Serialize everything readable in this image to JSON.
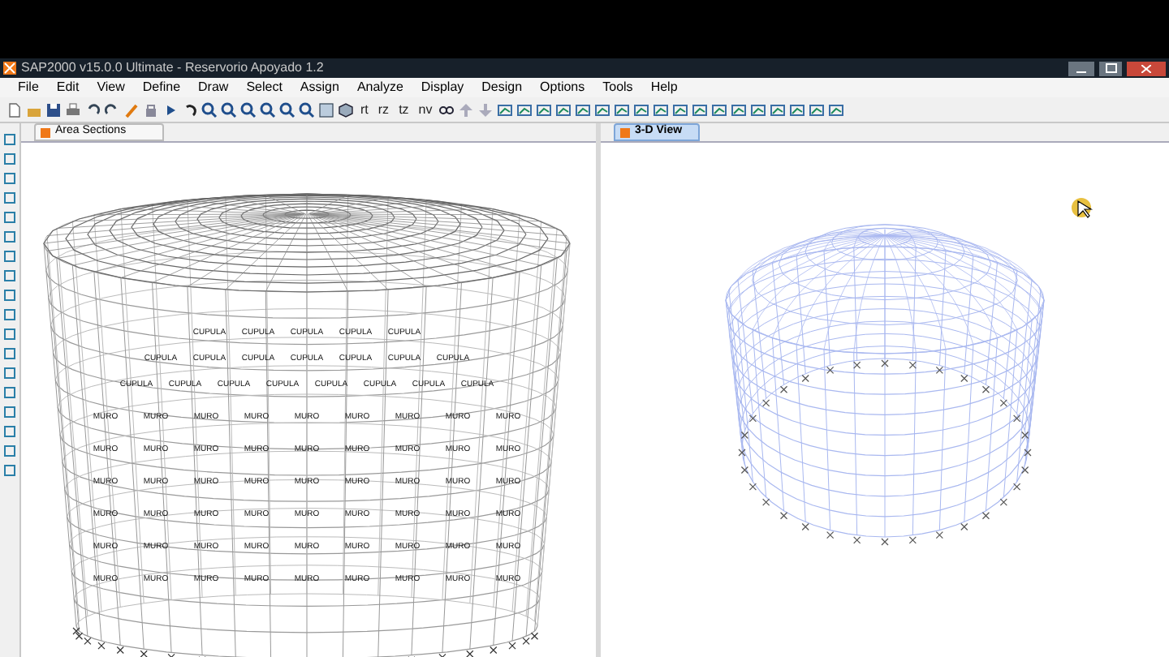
{
  "window": {
    "title": "SAP2000 v15.0.0 Ultimate  - Reservorio Apoyado 1.2"
  },
  "menu": [
    "File",
    "Edit",
    "View",
    "Define",
    "Draw",
    "Select",
    "Assign",
    "Analyze",
    "Display",
    "Design",
    "Options",
    "Tools",
    "Help"
  ],
  "toolbar_texts": [
    "rt",
    "rz",
    "tz",
    "nv"
  ],
  "panels": [
    {
      "title": "Area Sections",
      "selected": false,
      "kind": "sections"
    },
    {
      "title": "3-D View",
      "selected": true,
      "kind": "wireframe"
    }
  ],
  "area_labels": [
    [
      "CUPULA",
      "CUPULA",
      "CUPULA",
      "CUPULA",
      "CUPULA"
    ],
    [
      "CUPULA",
      "CUPULA",
      "CUPULA",
      "CUPULA",
      "CUPULA",
      "CUPULA",
      "CUPULA"
    ],
    [
      "CUPULA",
      "CUPULA",
      "CUPULA",
      "CUPULA",
      "CUPULA",
      "CUPULA",
      "CUPULA",
      "CUPULA"
    ],
    [
      "MURO",
      "MURO",
      "MURO",
      "MURO",
      "MURO",
      "MURO",
      "MURO",
      "MURO",
      "MURO"
    ],
    [
      "MURO",
      "MURO",
      "MURO",
      "MURO",
      "MURO",
      "MURO",
      "MURO",
      "MURO",
      "MURO"
    ],
    [
      "MURO",
      "MURO",
      "MURO",
      "MURO",
      "MURO",
      "MURO",
      "MURO",
      "MURO",
      "MURO"
    ],
    [
      "MURO",
      "MURO",
      "MURO",
      "MURO",
      "MURO",
      "MURO",
      "MURO",
      "MURO",
      "MURO"
    ],
    [
      "MURO",
      "MURO",
      "MURO",
      "MURO",
      "MURO",
      "MURO",
      "MURO",
      "MURO",
      "MURO"
    ],
    [
      "MURO",
      "MURO",
      "MURO",
      "MURO",
      "MURO",
      "MURO",
      "MURO",
      "MURO",
      "MURO"
    ]
  ]
}
